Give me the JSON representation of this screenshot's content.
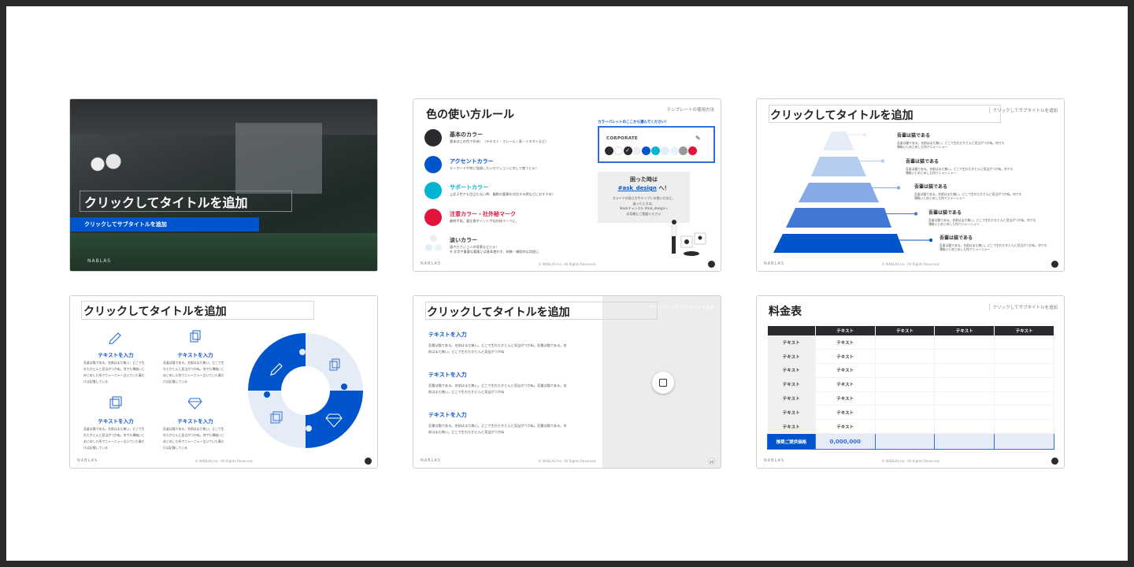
{
  "colors": {
    "accent": "#0055cc",
    "base": "#2b2b2f",
    "support": "#00b4d2",
    "alert": "#e0143c",
    "light": "#e8eef8"
  },
  "footer": {
    "logo": "NABLAS",
    "copyright": "© NABLAS Inc. All Rights Reserved"
  },
  "slides": [
    {
      "title": "クリックしてタイトルを追加",
      "subtitle": "クリックしてサブタイトルを追加"
    },
    {
      "title": "色の使い方ルール",
      "corner": "テンプレートの使用方法",
      "rules": [
        {
          "heading": "基本のカラー",
          "desc": "基本はこの色で作成！（テキスト・フレーム・表・イラストなど）",
          "color": "#2b2b2f"
        },
        {
          "heading": "アクセントカラー",
          "desc": "キーワードや特に強調したいセクションに対して使うと◎！",
          "color": "#0055cc"
        },
        {
          "heading": "サポートカラー",
          "desc": "上記２色でも目立たない時、複数の要素を対比する際などにおすすめ！",
          "color": "#00b4d2"
        },
        {
          "heading": "注意カラー・社外秘マーク",
          "desc": "最終手段。要注意ポイントや社外秘マークに。",
          "color": "#e0143c"
        },
        {
          "heading": "淡いカラー",
          "desc": "図やセクションの背景などに◎！",
          "desc2": "※ 文字や重要な要素には基本使わず、装飾・補助的な用途に",
          "color": "#eeeeee"
        }
      ],
      "palette_hint": "カラーパレットのここから選んでください！",
      "palette_name": "CORPORATE",
      "swatches": [
        "#2b2b2f",
        "#ffffff",
        "#2b2b2f",
        "#eeeeee",
        "#0055cc",
        "#00b4d2",
        "#e4ecf8",
        "#e6f4f8",
        "#999999",
        "#e0143c"
      ],
      "help": {
        "title": "困った時は",
        "link": "#ask_design",
        "link_suffix": " へ！",
        "lines": [
          "スライドの見せ方やテンプレの使い方など、",
          "迷ったときは、",
          "Slackチャンネル #ask_designへ",
          "お気軽にご相談ください"
        ]
      }
    },
    {
      "title": "クリックしてタイトルを追加",
      "subtitle": "クリックしてサブタイトルを追加",
      "levels": [
        {
          "heading": "吾輩は猫である",
          "text": "吾輩は猫である。名前はまだ無い。どこで生れたかとんと見当がつかぬ。何でも薄暗いじめじめした所でニャーニャー",
          "color": "#e5ecf8"
        },
        {
          "heading": "吾輩は猫である",
          "text": "吾輩は猫である。名前はまだ無い。どこで生れたかとんと見当がつかぬ。何でも薄暗いじめじめした所でニャーニャー",
          "color": "#b5cdf0"
        },
        {
          "heading": "吾輩は猫である",
          "text": "吾輩は猫である。名前はまだ無い。どこで生れたかとんと見当がつかぬ。何でも薄暗いじめじめした所でニャーニャー",
          "color": "#86aae6"
        },
        {
          "heading": "吾輩は猫である",
          "text": "吾輩は猫である。名前はまだ無い。どこで生れたかとんと見当がつかぬ。何でも薄暗いじめじめした所でニャーニャー",
          "color": "#4178d6"
        },
        {
          "heading": "吾輩は猫である",
          "text": "吾輩は猫である。名前はまだ無い。どこで生れたかとんと見当がつかぬ。何でも薄暗いじめじめした所でニャーニャー",
          "color": "#0055cc"
        }
      ]
    },
    {
      "title": "クリックしてタイトルを追加",
      "items": [
        {
          "icon": "pencil-icon",
          "heading": "テキストを入力",
          "text": "吾輩は猫である。名前はまだ無い。どこで生れたかとんと見当がつかぬ。何でも薄暗いじめじめした所でニャーニャー泣いていた事だけは記憶している"
        },
        {
          "icon": "documents-icon",
          "heading": "テキストを入力",
          "text": "吾輩は猫である。名前はまだ無い。どこで生れたかとんと見当がつかぬ。何でも薄暗いじめじめした所でニャーニャー泣いていた事だけは記憶している"
        },
        {
          "icon": "images-icon",
          "heading": "テキストを入力",
          "text": "吾輩は猫である。名前はまだ無い。どこで生れたかとんと見当がつかぬ。何でも薄暗いじめじめした所でニャーニャー泣いていた事だけは記憶している"
        },
        {
          "icon": "diamond-icon",
          "heading": "テキストを入力",
          "text": "吾輩は猫である。名前はまだ無い。どこで生れたかとんと見当がつかぬ。何でも薄暗いじめじめした所でニャーニャー泣いていた事だけは記憶している"
        }
      ]
    },
    {
      "title": "クリックしてタイトルを追加",
      "subtitle": "クリックしてサブタイトルを追加",
      "page": "20",
      "items": [
        {
          "heading": "テキストを入力",
          "text": "吾輩は猫である。名前はまだ無い。どこで生れたかとんと見当がつかぬ。吾輩は猫である。名前はまだ無い。どこで生れたかとんと見当がつかぬ"
        },
        {
          "heading": "テキストを入力",
          "text": "吾輩は猫である。名前はまだ無い。どこで生れたかとんと見当がつかぬ。吾輩は猫である。名前はまだ無い。どこで生れたかとんと見当がつかぬ"
        },
        {
          "heading": "テキストを入力",
          "text": "吾輩は猫である。名前はまだ無い。どこで生れたかとんと見当がつかぬ。吾輩は猫である。名前はまだ無い。どこで生れたかとんと見当がつかぬ"
        }
      ]
    },
    {
      "title": "料金表",
      "subtitle": "クリックしてサブタイトルを追加",
      "table": {
        "headers": [
          "",
          "テキスト",
          "テキスト",
          "テキスト",
          "テキスト"
        ],
        "rows": [
          [
            "テキスト",
            "テキスト",
            "",
            "",
            ""
          ],
          [
            "テキスト",
            "テキスト",
            "",
            "",
            ""
          ],
          [
            "テキスト",
            "テキスト",
            "",
            "",
            ""
          ],
          [
            "テキスト",
            "テキスト",
            "",
            "",
            ""
          ],
          [
            "テキスト",
            "テキスト",
            "",
            "",
            ""
          ],
          [
            "テキスト",
            "テキスト",
            "",
            "",
            ""
          ],
          [
            "テキスト",
            "テキスト",
            "",
            "",
            ""
          ]
        ],
        "footer": [
          "推奨ご提供価格",
          "0,000,000",
          "",
          "",
          ""
        ]
      }
    }
  ]
}
